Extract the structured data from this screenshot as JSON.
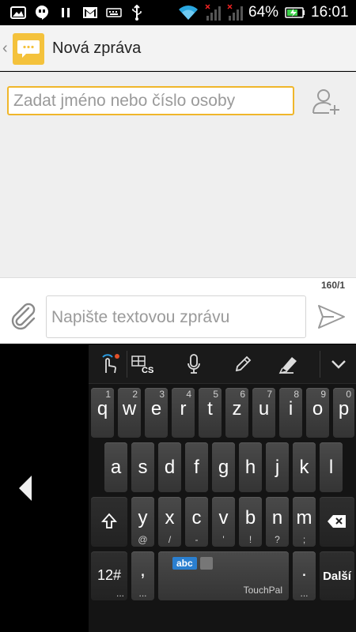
{
  "status_bar": {
    "battery": "64%",
    "time": "16:01"
  },
  "action_bar": {
    "title": "Nová zpráva"
  },
  "recipient": {
    "placeholder": "Zadat jméno nebo číslo osoby"
  },
  "compose": {
    "char_count": "160/1",
    "placeholder": "Napište textovou zprávu"
  },
  "keyboard": {
    "row1": [
      {
        "main": "q",
        "hint": "1"
      },
      {
        "main": "w",
        "hint": "2"
      },
      {
        "main": "e",
        "hint": "3"
      },
      {
        "main": "r",
        "hint": "4"
      },
      {
        "main": "t",
        "hint": "5"
      },
      {
        "main": "z",
        "hint": "6"
      },
      {
        "main": "u",
        "hint": "7"
      },
      {
        "main": "i",
        "hint": "8"
      },
      {
        "main": "o",
        "hint": "9"
      },
      {
        "main": "p",
        "hint": "0"
      }
    ],
    "row2": [
      "a",
      "s",
      "d",
      "f",
      "g",
      "h",
      "j",
      "k",
      "l"
    ],
    "row3": [
      {
        "main": "y",
        "sub": "@"
      },
      {
        "main": "x",
        "sub": "/"
      },
      {
        "main": "c",
        "sub": "-"
      },
      {
        "main": "v",
        "sub": "'"
      },
      {
        "main": "b",
        "sub": "!"
      },
      {
        "main": "n",
        "sub": "?"
      },
      {
        "main": "m",
        "sub": ";"
      }
    ],
    "sym_key": "12#",
    "sym_sub": "...",
    "comma": ",",
    "comma_sub": "...",
    "space_lang": "abc",
    "space_brand": "TouchPal",
    "period": ".",
    "period_sub": "...",
    "enter": "Další",
    "cs_label": "CS"
  }
}
